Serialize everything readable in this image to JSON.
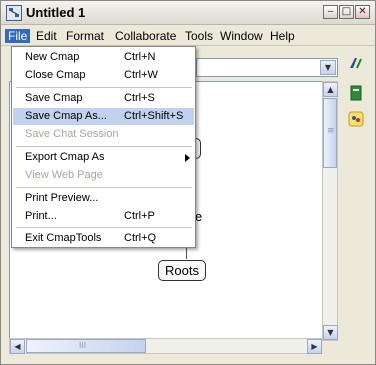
{
  "window": {
    "title": "Untitled 1"
  },
  "menubar": {
    "items": [
      "File",
      "Edit",
      "Format",
      "Collaborate",
      "Tools",
      "Window",
      "Help"
    ]
  },
  "file_menu": {
    "items": [
      {
        "label": "New Cmap",
        "shortcut": "Ctrl+N"
      },
      {
        "label": "Close Cmap",
        "shortcut": "Ctrl+W"
      },
      {
        "label": "Save Cmap",
        "shortcut": "Ctrl+S"
      },
      {
        "label": "Save Cmap As...",
        "shortcut": "Ctrl+Shift+S"
      },
      {
        "label": "Save Chat Session",
        "shortcut": ""
      },
      {
        "label": "Export Cmap As",
        "shortcut": ""
      },
      {
        "label": "View Web Page",
        "shortcut": ""
      },
      {
        "label": "Print Preview...",
        "shortcut": ""
      },
      {
        "label": "Print...",
        "shortcut": "Ctrl+P"
      },
      {
        "label": "Exit CmapTools",
        "shortcut": "Ctrl+Q"
      }
    ]
  },
  "canvas": {
    "nodes": [
      "s",
      "e",
      "Roots"
    ],
    "hscroll_thumb": "III",
    "vscroll_thumb": "≡"
  },
  "colors": {
    "highlight": "#c1d2ee",
    "menu_active": "#316ac5"
  }
}
